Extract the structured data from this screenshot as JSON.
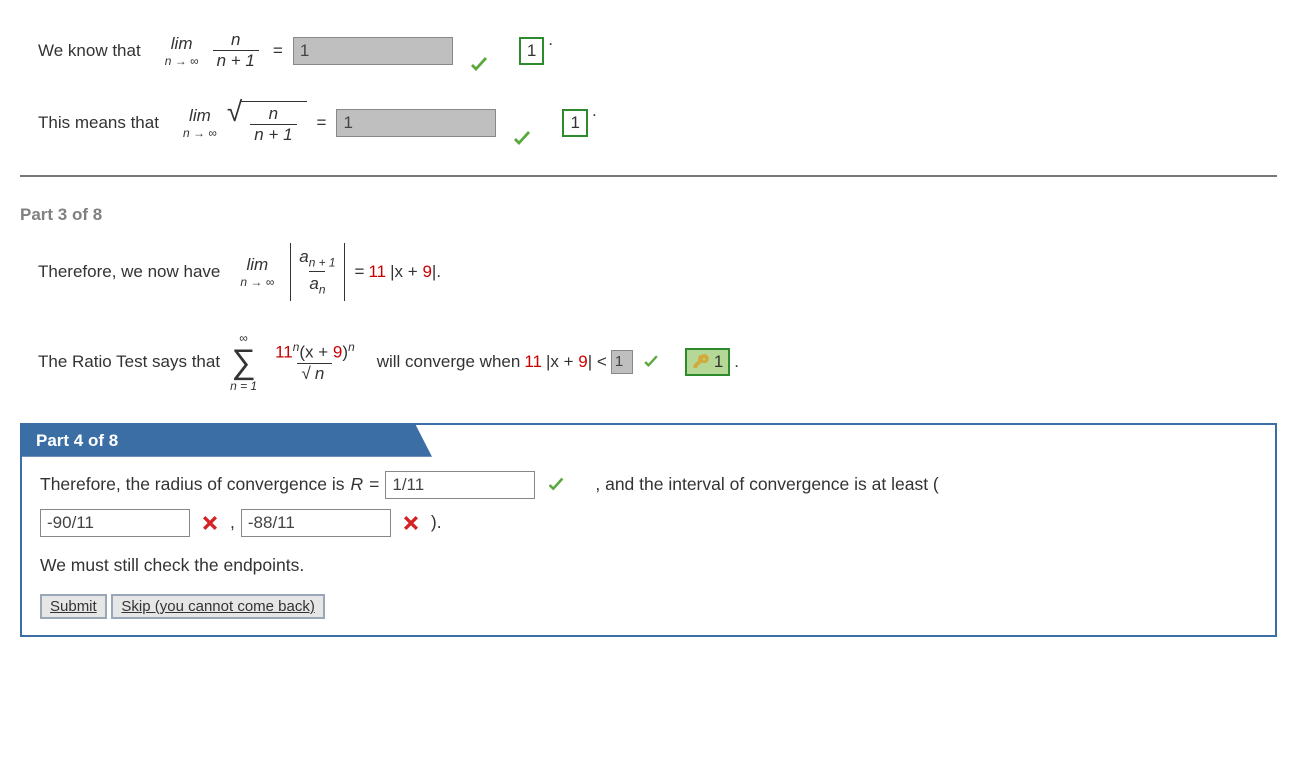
{
  "line1": {
    "text1": "We know that",
    "lim": "lim",
    "limsub": "n → ∞",
    "frac_num": "n",
    "frac_den": "n + 1",
    "eq": "=",
    "input": "1",
    "answer": "1",
    "dot": "."
  },
  "line2": {
    "text1": "This means that",
    "lim": "lim",
    "limsub": "n → ∞",
    "frac_num": "n",
    "frac_den": "n + 1",
    "eq": "=",
    "input": "1",
    "answer": "1",
    "dot": "."
  },
  "part3": {
    "label": "Part 3 of 8",
    "l1": {
      "text1": "Therefore, we now have",
      "lim": "lim",
      "limsub": "n → ∞",
      "abs_num_a": "a",
      "abs_num_sub": "n + 1",
      "abs_den_a": "a",
      "abs_den_sub": "n",
      "eq": " = ",
      "coef": "11",
      "rest": "|x + ",
      "nine": "9",
      "close": "|."
    },
    "l2": {
      "text1": "The Ratio Test says that",
      "sum_top": "∞",
      "sum_bot": "n = 1",
      "num_c1": "11",
      "num_sup1": "n",
      "num_mid": "(x + ",
      "num_nine": "9",
      "num_close": ")",
      "num_sup2": "n",
      "den_sqrt": "n",
      "text2": "will converge when ",
      "coef": "11",
      "rest": "|x + ",
      "nine": "9",
      "close": "| < ",
      "input": "1",
      "answer": "1",
      "dot": " ."
    }
  },
  "part4": {
    "tab": "Part 4 of 8",
    "l1": {
      "t1": "Therefore, the radius of convergence is ",
      "R": "R",
      "eq": " = ",
      "inputR": "1/11",
      "t2": ", and the interval of convergence is at least (",
      "inputA": "-90/11",
      "comma": " , ",
      "inputB": "-88/11",
      "close": " )."
    },
    "l2": "We must still check the endpoints.",
    "btnSubmit": "Submit",
    "btnSkip": "Skip (you cannot come back)"
  }
}
